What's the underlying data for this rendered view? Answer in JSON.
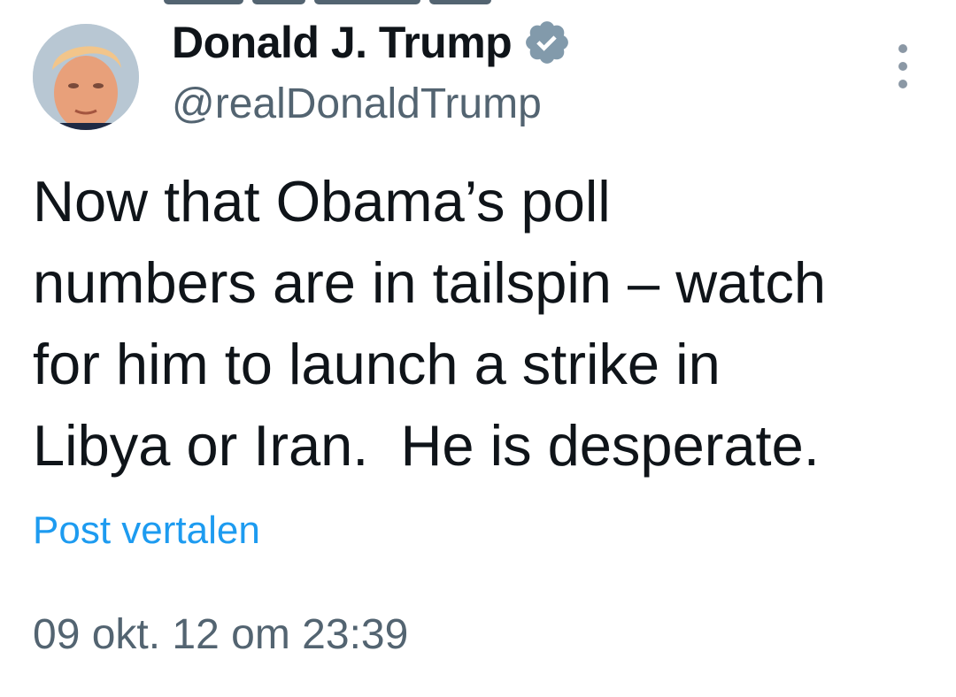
{
  "author": {
    "display_name": "Donald J. Trump",
    "handle": "@realDonaldTrump",
    "verified": true,
    "avatar_icon": "profile-photo"
  },
  "post": {
    "text": "Now that Obama’s poll\nnumbers are in tailspin – watch\nfor him to launch a strike in\nLibya or Iran.  He is desperate.",
    "translate_label": "Post vertalen",
    "timestamp": "09 okt. 12 om 23:39"
  },
  "menu": {
    "icon": "more-vertical-icon"
  },
  "colors": {
    "text_primary": "#0f1419",
    "text_secondary": "#536471",
    "link": "#1d9bf0",
    "verified_badge": "#829aab"
  }
}
